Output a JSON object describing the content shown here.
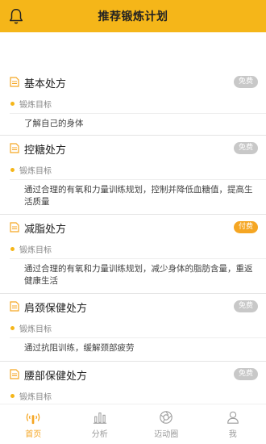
{
  "header": {
    "title": "推荐锻炼计划",
    "icon": "bell-icon"
  },
  "cards": [
    {
      "title": "基本处方",
      "badge": "免费",
      "paid": false,
      "goal_label": "锻炼目标",
      "description": "了解自己的身体"
    },
    {
      "title": "控糖处方",
      "badge": "免费",
      "paid": false,
      "goal_label": "锻炼目标",
      "description": "通过合理的有氧和力量训练规划，控制并降低血糖值，提高生活质量"
    },
    {
      "title": "减脂处方",
      "badge": "付费",
      "paid": true,
      "goal_label": "锻炼目标",
      "description": "通过合理的有氧和力量训练规划，减少身体的脂肪含量，重返健康生活"
    },
    {
      "title": "肩颈保健处方",
      "badge": "免费",
      "paid": false,
      "goal_label": "锻炼目标",
      "description": "通过抗阻训练，缓解颈部疲劳"
    },
    {
      "title": "腰部保健处方",
      "badge": "免费",
      "paid": false,
      "goal_label": "锻炼目标",
      "description": ""
    }
  ],
  "tabs": [
    {
      "label": "首页",
      "icon": "home-icon",
      "active": true
    },
    {
      "label": "分析",
      "icon": "bar-chart-icon",
      "active": false
    },
    {
      "label": "迈动圈",
      "icon": "circle-icon",
      "active": false
    },
    {
      "label": "我",
      "icon": "user-icon",
      "active": false
    }
  ],
  "colors": {
    "accent": "#f5b619",
    "paid_badge": "#f5a623",
    "free_badge": "#c8c8c8"
  }
}
